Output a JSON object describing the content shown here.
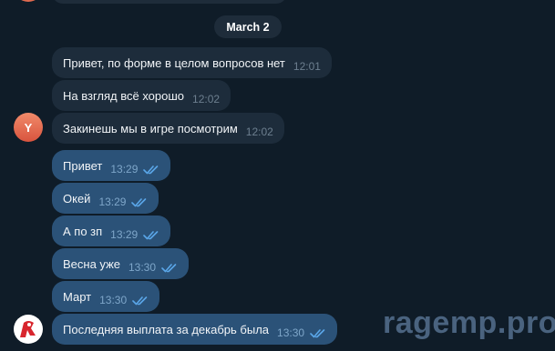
{
  "date_separator": "March 2",
  "incoming_avatar_letter": "Y",
  "messages": [
    {
      "direction": "in",
      "text": "Привет, по форме в целом вопросов нет",
      "time": "12:01"
    },
    {
      "direction": "in",
      "text": "На взгляд всё хорошо",
      "time": "12:02"
    },
    {
      "direction": "in",
      "text": "Закинешь мы в игре посмотрим",
      "time": "12:02"
    },
    {
      "direction": "out",
      "text": "Привет",
      "time": "13:29",
      "status": "read"
    },
    {
      "direction": "out",
      "text": "Окей",
      "time": "13:29",
      "status": "read"
    },
    {
      "direction": "out",
      "text": "А по зп",
      "time": "13:29",
      "status": "read"
    },
    {
      "direction": "out",
      "text": "Весна уже",
      "time": "13:30",
      "status": "read"
    },
    {
      "direction": "out",
      "text": "Март",
      "time": "13:30",
      "status": "read"
    },
    {
      "direction": "out",
      "text": "Последняя выплата за декабрь была",
      "time": "13:30",
      "status": "read"
    }
  ],
  "watermark": "ragemp.pro",
  "colors": {
    "background": "#0f1c28",
    "incoming_bubble": "#1d2c3b",
    "outgoing_bubble": "#2b5278",
    "read_checks": "#5aa6e8",
    "avatar_y": "#e06a4f"
  },
  "icons": {
    "read_status": "double-check-icon",
    "own_avatar": "ragemp-logo-avatar"
  }
}
